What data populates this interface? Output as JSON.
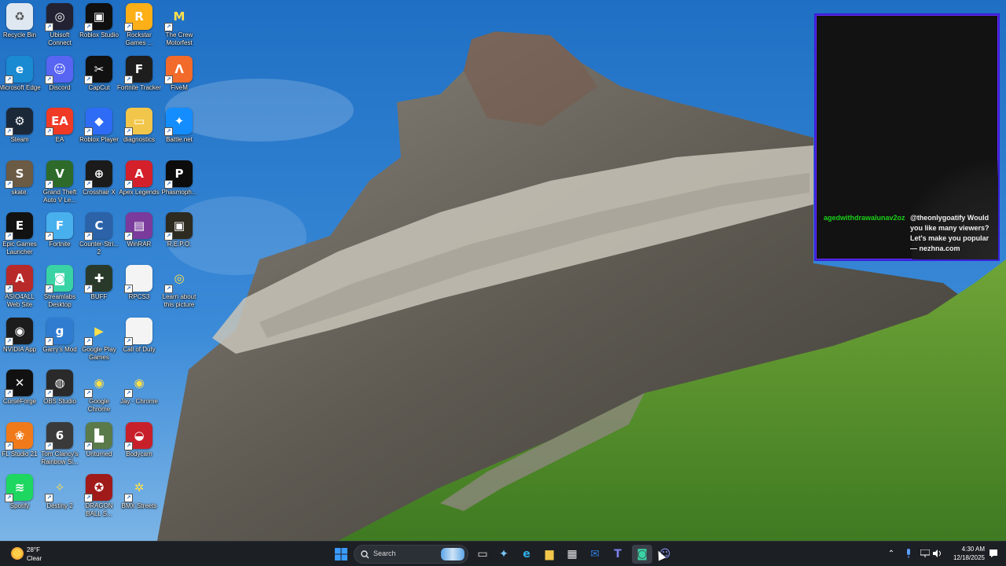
{
  "desktop": {
    "icons": [
      {
        "label": "Recycle Bin",
        "color": "#dfe8f1",
        "glyph": "♻",
        "icon": "recycle-bin-icon"
      },
      {
        "label": "Ubisoft Connect",
        "color": "#232232",
        "glyph": "◎",
        "icon": "ubisoft-icon"
      },
      {
        "label": "Roblox Studio",
        "color": "#101010",
        "glyph": "▣",
        "icon": "roblox-studio-icon"
      },
      {
        "label": "Rockstar Games ...",
        "color": "#fcaf17",
        "glyph": "R",
        "icon": "rockstar-icon"
      },
      {
        "label": "The Crew Motorfest",
        "color": "transparent",
        "glyph": "M",
        "icon": "crew-motorfest-icon"
      },
      {
        "label": "Microsoft Edge",
        "color": "#1a8ad2",
        "glyph": "e",
        "icon": "edge-icon"
      },
      {
        "label": "Discord",
        "color": "#5865f2",
        "glyph": "☺",
        "icon": "discord-icon"
      },
      {
        "label": "CapCut",
        "color": "#111111",
        "glyph": "✂",
        "icon": "capcut-icon"
      },
      {
        "label": "Fortnite Tracker",
        "color": "#1e1e1e",
        "glyph": "F",
        "icon": "fortnite-tracker-icon"
      },
      {
        "label": "FiveM",
        "color": "#f26b2a",
        "glyph": "Λ",
        "icon": "fivem-icon"
      },
      {
        "label": "Steam",
        "color": "#1b2838",
        "glyph": "⚙",
        "icon": "steam-icon"
      },
      {
        "label": "EA",
        "color": "#ef3a25",
        "glyph": "EA",
        "icon": "ea-icon"
      },
      {
        "label": "Roblox Player",
        "color": "#2f6cf5",
        "glyph": "◆",
        "icon": "roblox-player-icon"
      },
      {
        "label": "diagnostics",
        "color": "#f2c64a",
        "glyph": "▭",
        "icon": "folder-icon"
      },
      {
        "label": "Battle.net",
        "color": "#148eff",
        "glyph": "✦",
        "icon": "battlenet-icon"
      },
      {
        "label": "skate.",
        "color": "#6b5a44",
        "glyph": "S",
        "icon": "skate-icon"
      },
      {
        "label": "Grand Theft Auto V Le...",
        "color": "#2e6b2b",
        "glyph": "V",
        "icon": "gta-icon"
      },
      {
        "label": "Crosshair X",
        "color": "#1b1b1b",
        "glyph": "⊕",
        "icon": "crosshair-x-icon"
      },
      {
        "label": "Apex Legends",
        "color": "#d3202a",
        "glyph": "A",
        "icon": "apex-icon"
      },
      {
        "label": "Phasmoph...",
        "color": "#0c0c0c",
        "glyph": "P",
        "icon": "phasmophobia-icon"
      },
      {
        "label": "Epic Games Launcher",
        "color": "#121212",
        "glyph": "E",
        "icon": "epic-icon"
      },
      {
        "label": "Fortnite",
        "color": "#49b0ee",
        "glyph": "F",
        "icon": "fortnite-icon"
      },
      {
        "label": "Counter-Stri... 2",
        "color": "#2b62a8",
        "glyph": "C",
        "icon": "counter-strike-icon"
      },
      {
        "label": "WinRAR",
        "color": "#7a3b9c",
        "glyph": "▤",
        "icon": "winrar-icon"
      },
      {
        "label": "R.E.P.O.",
        "color": "#2d2a20",
        "glyph": "▣",
        "icon": "repo-icon"
      },
      {
        "label": "ASIO4ALL Web Site",
        "color": "#b82a2a",
        "glyph": "A",
        "icon": "asio-icon"
      },
      {
        "label": "Streamlabs Desktop",
        "color": "#3ad3a5",
        "glyph": "◙",
        "icon": "streamlabs-icon"
      },
      {
        "label": "BUFF",
        "color": "#2a3a2a",
        "glyph": "✚",
        "icon": "buff-icon"
      },
      {
        "label": "RPCS3",
        "color": "#f4f4f4",
        "glyph": "",
        "icon": "file-icon"
      },
      {
        "label": "Learn about this picture",
        "color": "transparent",
        "glyph": "◎",
        "icon": "learn-picture-icon"
      },
      {
        "label": "NVIDIA App",
        "color": "#1c1c1c",
        "glyph": "◉",
        "icon": "nvidia-icon"
      },
      {
        "label": "Garry's Mod",
        "color": "#2f7cd0",
        "glyph": "g",
        "icon": "garrys-mod-icon"
      },
      {
        "label": "Google Play Games",
        "color": "transparent",
        "glyph": "▶",
        "icon": "google-play-games-icon"
      },
      {
        "label": "Call of Duty",
        "color": "#f4f4f4",
        "glyph": "",
        "icon": "file-icon"
      },
      {
        "label": "",
        "color": "transparent",
        "glyph": "",
        "icon": "empty-slot"
      },
      {
        "label": "CurseForge",
        "color": "#111111",
        "glyph": "✕",
        "icon": "curseforge-icon"
      },
      {
        "label": "OBS Studio",
        "color": "#2a2a2a",
        "glyph": "◍",
        "icon": "obs-icon"
      },
      {
        "label": "Google Chrome",
        "color": "transparent",
        "glyph": "◉",
        "icon": "chrome-icon"
      },
      {
        "label": "Jay - Chrome",
        "color": "transparent",
        "glyph": "◉",
        "icon": "chrome-profile-icon"
      },
      {
        "label": "",
        "color": "transparent",
        "glyph": "",
        "icon": "empty-slot"
      },
      {
        "label": "FL Studio 21",
        "color": "#f07a1a",
        "glyph": "❀",
        "icon": "fl-studio-icon"
      },
      {
        "label": "Tom Clancy's Rainbow Si...",
        "color": "#3a3a3a",
        "glyph": "6",
        "icon": "rainbow-six-icon"
      },
      {
        "label": "Unturned",
        "color": "#5a7a4a",
        "glyph": "▙",
        "icon": "unturned-icon"
      },
      {
        "label": "Bodycam",
        "color": "#c8202a",
        "glyph": "◒",
        "icon": "bodycam-icon"
      },
      {
        "label": "",
        "color": "transparent",
        "glyph": "",
        "icon": "empty-slot"
      },
      {
        "label": "Spotify",
        "color": "#1ed760",
        "glyph": "≋",
        "icon": "spotify-icon"
      },
      {
        "label": "Destiny 2",
        "color": "transparent",
        "glyph": "✧",
        "icon": "destiny-icon"
      },
      {
        "label": "DRAGON BALL S...",
        "color": "#a01a1a",
        "glyph": "✪",
        "icon": "dragon-ball-icon"
      },
      {
        "label": "BMX Streets",
        "color": "transparent",
        "glyph": "✲",
        "icon": "bmx-streets-icon"
      }
    ]
  },
  "chat": {
    "username": "agedwithdrawalunav2oz",
    "message": "@theonlygoatify Would you like many viewers? Let's make you popular — nezhna.com",
    "border_color": "#3a1fd6",
    "username_color": "#19d219"
  },
  "taskbar": {
    "weather_temp": "28°F",
    "weather_desc": "Clear",
    "search_placeholder": "Search",
    "apps": [
      {
        "name": "start-button",
        "glyph": "⊞",
        "color": "#3a9bff"
      },
      {
        "name": "task-view-button",
        "glyph": "▭",
        "color": "#e0e0e0"
      },
      {
        "name": "copilot-button",
        "glyph": "✦",
        "color": "#7bc6ff"
      },
      {
        "name": "edge-button",
        "glyph": "e",
        "color": "#2fb0e8"
      },
      {
        "name": "file-explorer-button",
        "glyph": "▆",
        "color": "#f2c64a"
      },
      {
        "name": "microsoft-store-button",
        "glyph": "▦",
        "color": "#e8e8e8"
      },
      {
        "name": "outlook-button",
        "glyph": "✉",
        "color": "#2d7bd6"
      },
      {
        "name": "teams-button",
        "glyph": "T",
        "color": "#7b83eb"
      },
      {
        "name": "streamlabs-button",
        "glyph": "◙",
        "color": "#3ad3a5"
      },
      {
        "name": "discord-button",
        "glyph": "☺",
        "color": "#8f9cff"
      }
    ],
    "time": "4:30 AM",
    "date": "12/18/2025"
  }
}
